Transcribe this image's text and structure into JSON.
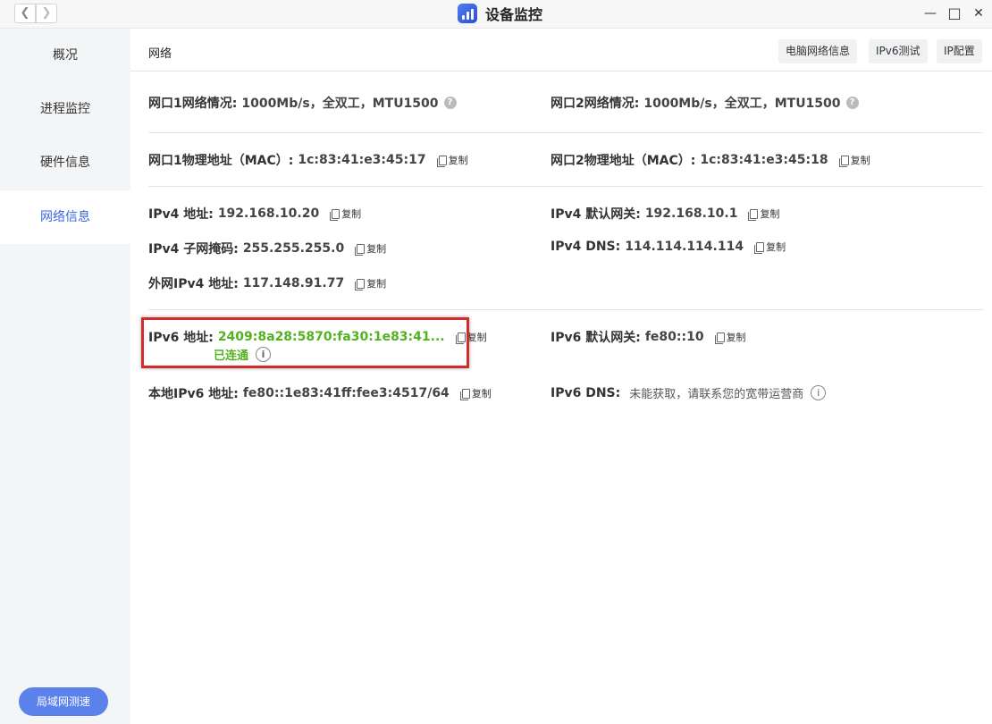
{
  "window": {
    "title": "设备监控",
    "back_glyph": "❮",
    "forward_glyph": "❯",
    "minimize_glyph": "—",
    "maximize_glyph": "□",
    "close_glyph": "✕"
  },
  "sidebar": {
    "items": [
      {
        "label": "概况",
        "active": false
      },
      {
        "label": "进程监控",
        "active": false
      },
      {
        "label": "硬件信息",
        "active": false
      },
      {
        "label": "网络信息",
        "active": true
      }
    ],
    "lan_speed_button": "局域网测速"
  },
  "main": {
    "section_title": "网络",
    "buttons": {
      "pc_network_info": "电脑网络信息",
      "ipv6_test": "IPv6测试",
      "ip_config": "IP配置"
    },
    "copy_label": "复制",
    "port1_status": {
      "label": "网口1网络情况:",
      "value": "1000Mb/s，全双工，MTU1500"
    },
    "port2_status": {
      "label": "网口2网络情况:",
      "value": "1000Mb/s，全双工，MTU1500"
    },
    "port1_mac": {
      "label": "网口1物理地址（MAC）:",
      "value": "1c:83:41:e3:45:17"
    },
    "port2_mac": {
      "label": "网口2物理地址（MAC）:",
      "value": "1c:83:41:e3:45:18"
    },
    "ipv4_address": {
      "label": "IPv4 地址:",
      "value": "192.168.10.20"
    },
    "ipv4_gateway": {
      "label": "IPv4 默认网关:",
      "value": "192.168.10.1"
    },
    "ipv4_mask": {
      "label": "IPv4 子网掩码:",
      "value": "255.255.255.0"
    },
    "ipv4_dns": {
      "label": "IPv4 DNS:",
      "value": "114.114.114.114"
    },
    "public_ipv4": {
      "label": "外网IPv4 地址:",
      "value": "117.148.91.77"
    },
    "ipv6_address": {
      "label": "IPv6 地址:",
      "value": "2409:8a28:5870:fa30:1e83:41...",
      "status": "已连通"
    },
    "ipv6_gateway": {
      "label": "IPv6 默认网关:",
      "value": "fe80::10"
    },
    "local_ipv6": {
      "label": "本地IPv6 地址:",
      "value": "fe80::1e83:41ff:fee3:4517/64"
    },
    "ipv6_dns": {
      "label": "IPv6 DNS:",
      "value": "未能获取，请联系您的宽带运营商"
    }
  },
  "colors": {
    "accent": "#3b66e0",
    "connected_green": "#52b21f",
    "highlight_red": "#d22b2b"
  }
}
